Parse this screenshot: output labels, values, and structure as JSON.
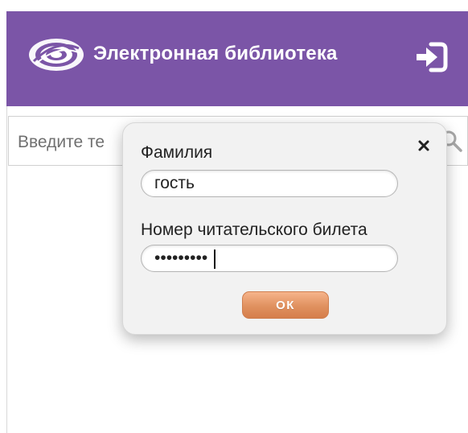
{
  "header": {
    "title": "Электронная библиотека",
    "logo_icon": "eye-swirl-logo",
    "login_icon": "sign-in-icon",
    "background_color": "#7b55a7"
  },
  "search": {
    "placeholder": "Введите те",
    "icon": "search-icon"
  },
  "login_dialog": {
    "surname_label": "Фамилия",
    "surname_value": "гость",
    "ticket_label": "Номер читательского билета",
    "ticket_value": "•••••••••",
    "ok_label": "ОК",
    "close_icon": "close-icon",
    "ok_color": "#e0915f"
  }
}
